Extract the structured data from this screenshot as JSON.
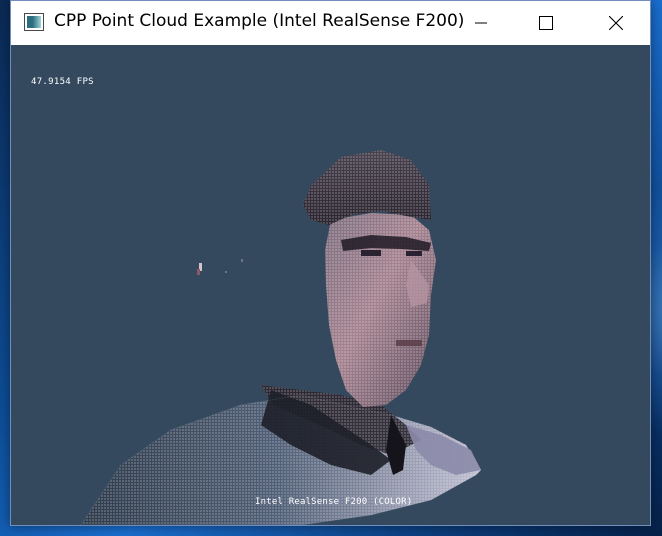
{
  "window": {
    "title": "CPP Point Cloud Example (Intel RealSense F200)"
  },
  "overlay": {
    "fps": "47.9154 FPS",
    "camera": "Intel RealSense F200 (COLOR)"
  },
  "colors": {
    "viewport_background": "#34495e",
    "overlay_text": "#ffffff"
  },
  "icons": {
    "app": "app-window-icon",
    "minimize": "minimize-icon",
    "maximize": "maximize-icon",
    "close": "close-icon"
  }
}
